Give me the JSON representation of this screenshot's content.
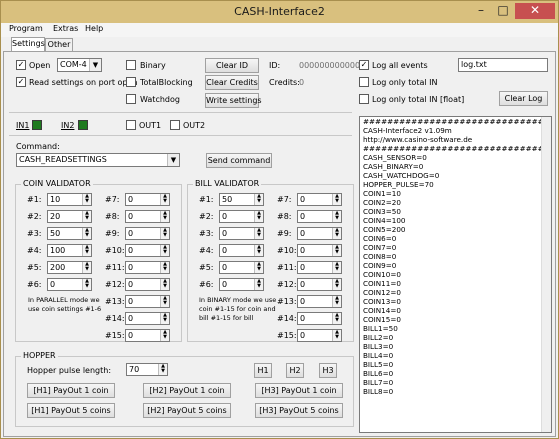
{
  "window": {
    "title": "CASH-Interface2",
    "minimize": "–",
    "maximize": "□",
    "close": "✕"
  },
  "menu": [
    "Program",
    "Extras",
    "Help"
  ],
  "tabs": [
    "Settings",
    "Other"
  ],
  "port": {
    "open_label": "Open",
    "open_checked": true,
    "combo_value": "COM-4",
    "read_settings_label": "Read settings on port open",
    "read_settings_checked": true
  },
  "options": [
    {
      "label": "Binary",
      "checked": false
    },
    {
      "label": "TotalBlocking",
      "checked": false
    },
    {
      "label": "Watchdog",
      "checked": false
    }
  ],
  "buttons": {
    "clear_id": "Clear ID",
    "clear_credits": "Clear Credits",
    "write_settings": "Write settings",
    "clear_log": "Clear Log",
    "send_command": "Send command"
  },
  "info": {
    "id_label": "ID:",
    "id_value": "000000000000",
    "credits_label": "Credits:",
    "credits_value": "0"
  },
  "logopts": [
    {
      "label": "Log all events",
      "checked": true
    },
    {
      "label": "Log only total IN",
      "checked": false
    },
    {
      "label": "Log only total IN [float]",
      "checked": false
    }
  ],
  "logfile": "log.txt",
  "io": {
    "in1": "IN1",
    "in2": "IN2",
    "out1": "OUT1",
    "out2": "OUT2"
  },
  "command": {
    "label": "Command:",
    "value": "CASH_READSETTINGS"
  },
  "coin": {
    "title": "COIN VALIDATOR",
    "left": [
      {
        "label": "#1:",
        "value": "10"
      },
      {
        "label": "#2:",
        "value": "20"
      },
      {
        "label": "#3:",
        "value": "50"
      },
      {
        "label": "#4:",
        "value": "100"
      },
      {
        "label": "#5:",
        "value": "200"
      },
      {
        "label": "#6:",
        "value": "0"
      }
    ],
    "right": [
      {
        "label": "#7:",
        "value": "0"
      },
      {
        "label": "#8:",
        "value": "0"
      },
      {
        "label": "#9:",
        "value": "0"
      },
      {
        "label": "#10:",
        "value": "0"
      },
      {
        "label": "#11:",
        "value": "0"
      },
      {
        "label": "#12:",
        "value": "0"
      },
      {
        "label": "#13:",
        "value": "0"
      },
      {
        "label": "#14:",
        "value": "0"
      },
      {
        "label": "#15:",
        "value": "0"
      }
    ],
    "note1": "In PARALLEL mode we",
    "note2": "use coin settings #1-6"
  },
  "bill": {
    "title": "BILL VALIDATOR",
    "left": [
      {
        "label": "#1:",
        "value": "50"
      },
      {
        "label": "#2:",
        "value": "0"
      },
      {
        "label": "#3:",
        "value": "0"
      },
      {
        "label": "#4:",
        "value": "0"
      },
      {
        "label": "#5:",
        "value": "0"
      },
      {
        "label": "#6:",
        "value": "0"
      }
    ],
    "right": [
      {
        "label": "#7:",
        "value": "0"
      },
      {
        "label": "#8:",
        "value": "0"
      },
      {
        "label": "#9:",
        "value": "0"
      },
      {
        "label": "#10:",
        "value": "0"
      },
      {
        "label": "#11:",
        "value": "0"
      },
      {
        "label": "#12:",
        "value": "0"
      },
      {
        "label": "#13:",
        "value": "0"
      },
      {
        "label": "#14:",
        "value": "0"
      },
      {
        "label": "#15:",
        "value": "0"
      }
    ],
    "note1": "In BINARY mode we use",
    "note2": "coin #1-15 for coin and",
    "note3": "bill #1-15 for bill"
  },
  "hopper": {
    "title": "HOPPER",
    "pulse_label": "Hopper pulse length:",
    "pulse_value": "70",
    "h_buttons": [
      "H1",
      "H2",
      "H3"
    ],
    "payout1": [
      "[H1] PayOut 1 coin",
      "[H2] PayOut 1 coin",
      "[H3] PayOut 1 coin"
    ],
    "payout5": [
      "[H1] PayOut 5 coins",
      "[H2] PayOut 5 coins",
      "[H3] PayOut 5 coins"
    ]
  },
  "log_lines": [
    "##############################",
    "CASH-Interface2 v1.09m",
    "http://www.casino-software.de",
    "##############################",
    "CASH_SENSOR=0",
    "CASH_BINARY=0",
    "CASH_WATCHDOG=0",
    "HOPPER_PULSE=70",
    "COIN1=10",
    "COIN2=20",
    "COIN3=50",
    "COIN4=100",
    "COIN5=200",
    "COIN6=0",
    "COIN7=0",
    "COIN8=0",
    "COIN9=0",
    "COIN10=0",
    "COIN11=0",
    "COIN12=0",
    "COIN13=0",
    "COIN14=0",
    "COIN15=0",
    "BILL1=50",
    "BILL2=0",
    "BILL3=0",
    "BILL4=0",
    "BILL5=0",
    "BILL6=0",
    "BILL7=0",
    "BILL8=0"
  ]
}
